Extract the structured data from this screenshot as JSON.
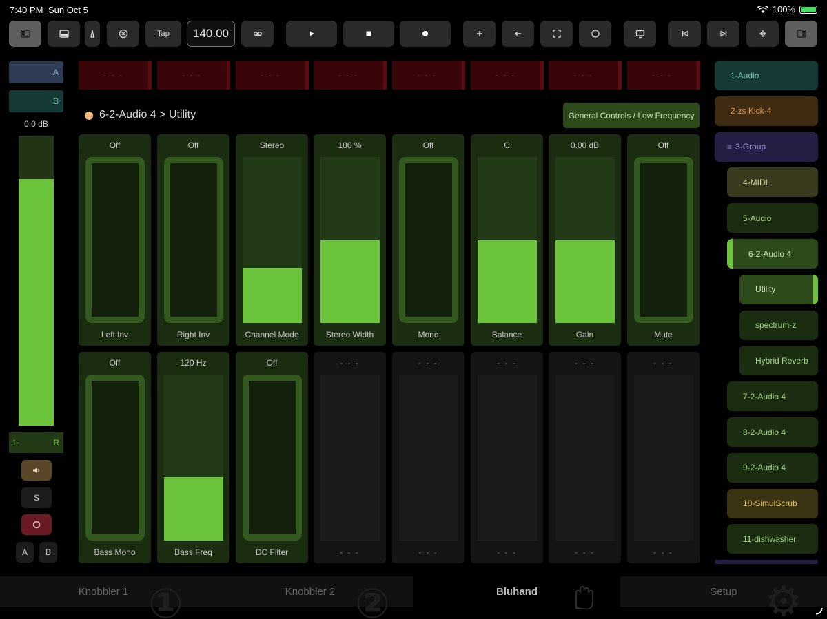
{
  "status_bar": {
    "time": "7:40 PM",
    "date": "Sun Oct 5",
    "battery": "100%"
  },
  "toolbar": {
    "tap_label": "Tap",
    "bpm": "140.00"
  },
  "left_strip": {
    "slot_a": "A",
    "slot_b": "B",
    "volume": "0.0 dB",
    "volume_level": 0.85,
    "pan_left": "L",
    "pan_right": "R",
    "solo": "S",
    "xfade_a": "A",
    "xfade_b": "B"
  },
  "clips": [
    "- - -",
    "- - -",
    "- - -",
    "- - -",
    "- - -",
    "- - -",
    "- - -",
    "- - -"
  ],
  "device": {
    "path": "6-2-Audio 4 > Utility",
    "page": "General Controls / Low Frequency"
  },
  "params_row1": [
    {
      "value": "Off",
      "label": "Left Inv",
      "kind": "toggle"
    },
    {
      "value": "Off",
      "label": "Right Inv",
      "kind": "toggle"
    },
    {
      "value": "Stereo",
      "label": "Channel Mode",
      "kind": "slider",
      "level": 0.33
    },
    {
      "value": "100 %",
      "label": "Stereo Width",
      "kind": "slider",
      "level": 0.5
    },
    {
      "value": "Off",
      "label": "Mono",
      "kind": "toggle"
    },
    {
      "value": "C",
      "label": "Balance",
      "kind": "slider",
      "level": 0.5
    },
    {
      "value": "0.00 dB",
      "label": "Gain",
      "kind": "slider",
      "level": 0.5
    },
    {
      "value": "Off",
      "label": "Mute",
      "kind": "toggle"
    }
  ],
  "params_row2": [
    {
      "value": "Off",
      "label": "Bass Mono",
      "kind": "toggle"
    },
    {
      "value": "120 Hz",
      "label": "Bass Freq",
      "kind": "slider",
      "level": 0.38
    },
    {
      "value": "Off",
      "label": "DC Filter",
      "kind": "toggle"
    },
    {
      "value": "- - -",
      "label": "- - -",
      "kind": "empty"
    },
    {
      "value": "- - -",
      "label": "- - -",
      "kind": "empty"
    },
    {
      "value": "- - -",
      "label": "- - -",
      "kind": "empty"
    },
    {
      "value": "- - -",
      "label": "- - -",
      "kind": "empty"
    },
    {
      "value": "- - -",
      "label": "- - -",
      "kind": "empty"
    }
  ],
  "tracks": [
    {
      "name": "1-Audio",
      "bg": "#163a35",
      "fg": "#86d0c4"
    },
    {
      "name": "2-zs Kick-4",
      "bg": "#3f2a12",
      "fg": "#e0a050"
    },
    {
      "name": "3-Group",
      "bg": "#261f45",
      "fg": "#9f8fe0"
    },
    {
      "name": "4-MIDI",
      "bg": "#3a3a1e",
      "fg": "#d8d8a0"
    },
    {
      "name": "5-Audio",
      "bg": "#1b2d11",
      "fg": "#a9d68a"
    },
    {
      "name": "6-2-Audio 4",
      "bg": "#2d4a1a",
      "fg": "#d6ecc4"
    },
    {
      "name": "Utility",
      "bg": "#2d4a1a",
      "fg": "#d6ecc4"
    },
    {
      "name": "spectrum-z",
      "bg": "#1b2d11",
      "fg": "#a9d68a"
    },
    {
      "name": "Hybrid Reverb",
      "bg": "#1b2d11",
      "fg": "#a9d68a"
    },
    {
      "name": "7-2-Audio 4",
      "bg": "#1b2d11",
      "fg": "#a9d68a"
    },
    {
      "name": "8-2-Audio 4",
      "bg": "#1b2d11",
      "fg": "#a9d68a"
    },
    {
      "name": "9-2-Audio 4",
      "bg": "#1b2d11",
      "fg": "#a9d68a"
    },
    {
      "name": "10-SimulScrub",
      "bg": "#3b3312",
      "fg": "#e8cc6a"
    },
    {
      "name": "11-dishwasher",
      "bg": "#1b2d11",
      "fg": "#a9d68a"
    }
  ],
  "tabs": [
    "Knobbler 1",
    "Knobbler 2",
    "Bluhand",
    "Setup"
  ],
  "colors": {
    "accent": "#6bc43c",
    "cell_bg": "#1b2d11",
    "clip_bg": "#3a0508"
  }
}
